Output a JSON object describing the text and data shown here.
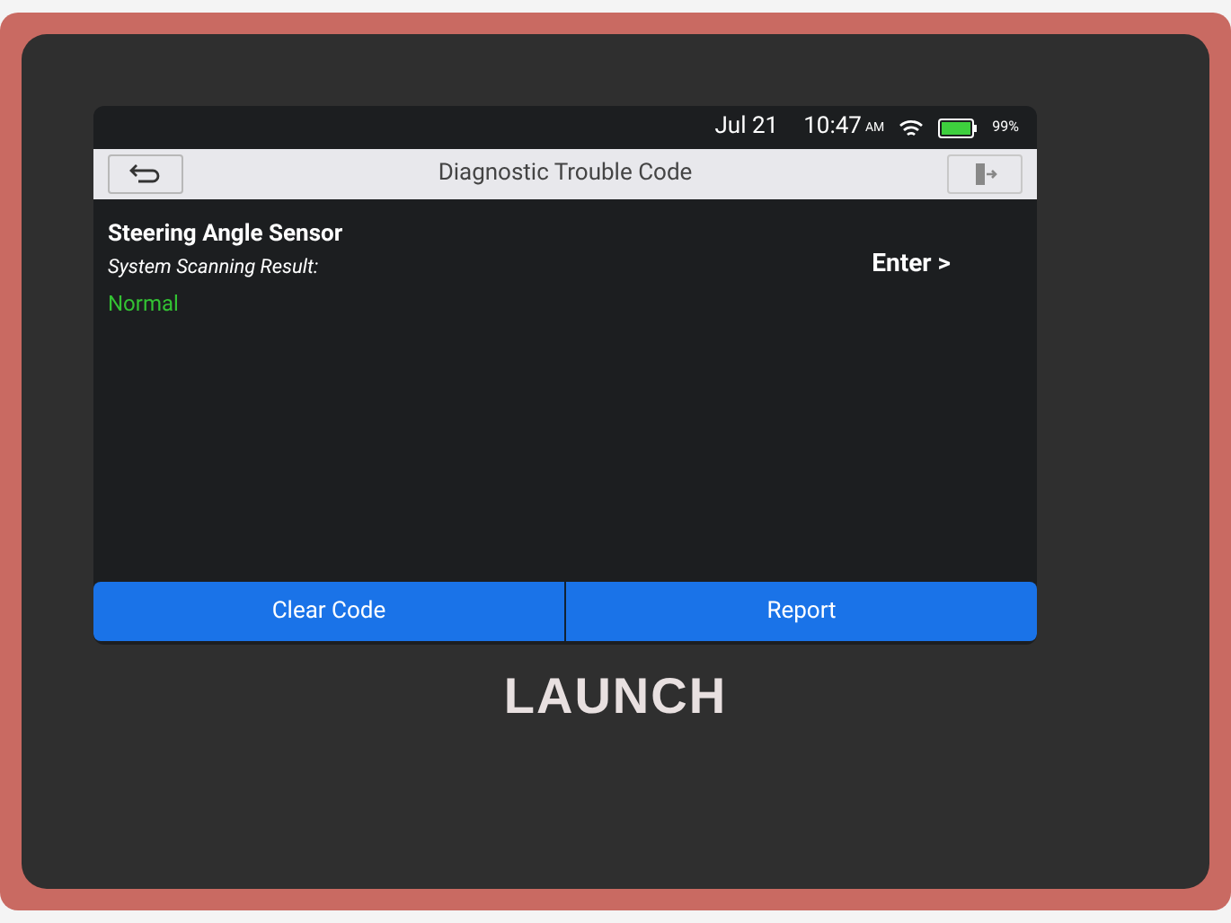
{
  "status_bar": {
    "date": "Jul 21",
    "time": "10:47",
    "meridiem": "AM",
    "battery": "99%"
  },
  "header": {
    "title": "Diagnostic Trouble Code"
  },
  "result": {
    "system": "Steering Angle Sensor",
    "label": "System Scanning Result:",
    "status": "Normal",
    "enter": "Enter >"
  },
  "buttons": [
    "Clear Code",
    "Report"
  ],
  "brand": "LAUNCH"
}
